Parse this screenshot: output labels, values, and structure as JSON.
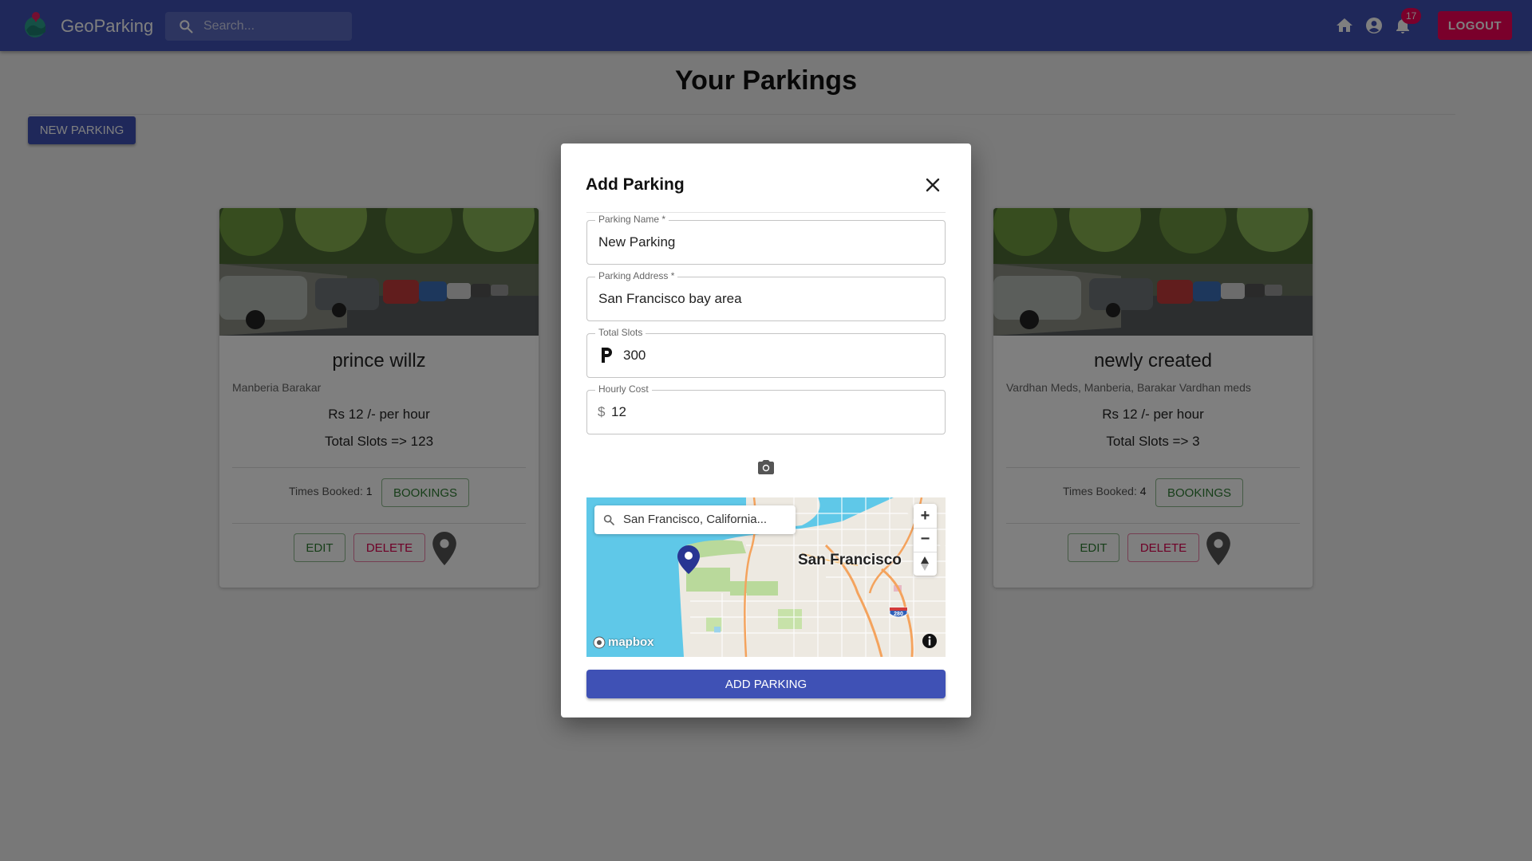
{
  "app": {
    "brand": "GeoParking",
    "search_placeholder": "Search...",
    "notification_count": "17",
    "logout_label": "LOGOUT"
  },
  "page": {
    "title": "Your Parkings",
    "new_parking_label": "NEW PARKING"
  },
  "cards": [
    {
      "name": "prince willz",
      "address": "Manberia Barakar",
      "cost": "Rs 12 /- per hour",
      "slots": "Total Slots => 123",
      "times_booked_label": "Times Booked:",
      "times_booked": "1",
      "bookings_label": "BOOKINGS",
      "edit_label": "EDIT",
      "delete_label": "DELETE"
    },
    {
      "name": "newly created",
      "address": "Vardhan Meds, Manberia, Barakar Vardhan meds",
      "cost": "Rs 12 /- per hour",
      "slots": "Total Slots => 3",
      "times_booked_label": "Times Booked:",
      "times_booked": "4",
      "bookings_label": "BOOKINGS",
      "edit_label": "EDIT",
      "delete_label": "DELETE"
    }
  ],
  "dialog": {
    "title": "Add Parking",
    "fields": {
      "name": {
        "label": "Parking Name *",
        "value": "New Parking"
      },
      "address": {
        "label": "Parking Address *",
        "value": "San Francisco bay area"
      },
      "slots": {
        "label": "Total Slots",
        "value": "300"
      },
      "cost": {
        "label": "Hourly Cost",
        "adornment": "$",
        "value": "12"
      }
    },
    "map": {
      "search_text": "San Francisco, California...",
      "city_label": "San Francisco",
      "attribution": "mapbox",
      "zoom_in": "+",
      "zoom_out": "−",
      "highway_shield": "280"
    },
    "submit_label": "ADD PARKING"
  },
  "colors": {
    "primary": "#3f51b5",
    "secondary": "#f50057",
    "success": "#2e7d32"
  }
}
